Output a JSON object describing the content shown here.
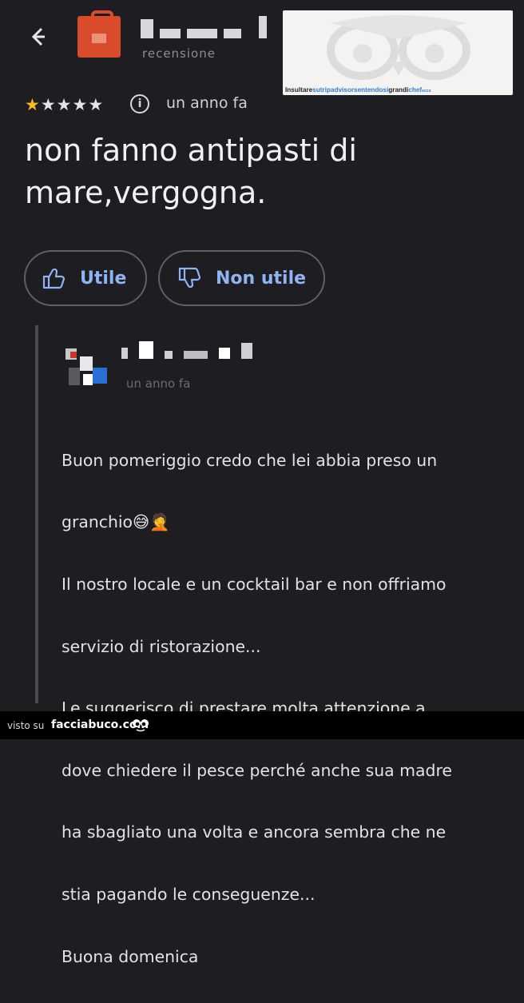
{
  "header": {
    "subtitle": "recensione",
    "back_icon": "back-arrow-icon",
    "avatar_color": "#d94b2b"
  },
  "watermark": {
    "part1": "Insultare",
    "part2": "sutripadvisor",
    "part3": "sentendosi",
    "part4": "grandi",
    "part5": "chef",
    "part6": "ecco"
  },
  "review": {
    "rating": 1,
    "max_rating": 5,
    "star_icon": "star-icon",
    "info_icon_label": "i",
    "time_ago": "un anno fa",
    "text": "non fanno antipasti di mare,vergogna."
  },
  "actions": {
    "useful_label": "Utile",
    "not_useful_label": "Non utile",
    "accent": "#8fb4f3"
  },
  "reply": {
    "subtitle": "un anno fa",
    "lines": [
      "Buon pomeriggio credo che lei abbia preso un",
      "granchio😅🤦",
      "Il nostro locale e un cocktail bar e non offriamo",
      "servizio di ristorazione...",
      "Le suggerisco di prestare molta attenzione a",
      "dove chiedere il pesce perché anche sua madre",
      "ha sbagliato una volta e ancora sembra che ne",
      "stia pagando le conseguenze...",
      "Buona domenica"
    ]
  },
  "footer": {
    "prefix": "visto su",
    "brand": "facciabuco.com"
  }
}
